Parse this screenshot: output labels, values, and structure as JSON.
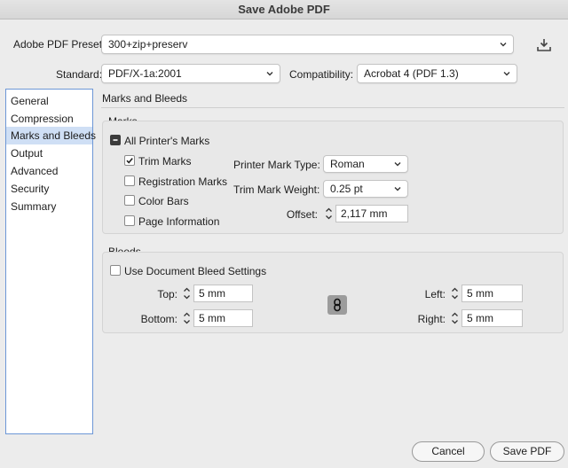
{
  "window": {
    "title": "Save Adobe PDF"
  },
  "preset": {
    "label": "Adobe PDF Preset:",
    "value": "300+zip+preserv"
  },
  "standard": {
    "label": "Standard:",
    "value": "PDF/X-1a:2001"
  },
  "compatibility": {
    "label": "Compatibility:",
    "value": "Acrobat 4 (PDF 1.3)"
  },
  "sidebar": {
    "items": [
      {
        "label": "General"
      },
      {
        "label": "Compression"
      },
      {
        "label": "Marks and Bleeds"
      },
      {
        "label": "Output"
      },
      {
        "label": "Advanced"
      },
      {
        "label": "Security"
      },
      {
        "label": "Summary"
      }
    ],
    "selected_index": 2
  },
  "panel": {
    "title": "Marks and Bleeds"
  },
  "marks": {
    "group_label": "Marks",
    "all_printers_marks": {
      "label": "All Printer's Marks",
      "state": "mixed"
    },
    "trim_marks": {
      "label": "Trim Marks",
      "checked": true
    },
    "registration_marks": {
      "label": "Registration Marks",
      "checked": false
    },
    "color_bars": {
      "label": "Color Bars",
      "checked": false
    },
    "page_information": {
      "label": "Page Information",
      "checked": false
    },
    "printer_mark_type": {
      "label": "Printer Mark Type:",
      "value": "Roman"
    },
    "trim_mark_weight": {
      "label": "Trim Mark Weight:",
      "value": "0.25 pt"
    },
    "offset": {
      "label": "Offset:",
      "value": "2,117 mm"
    }
  },
  "bleeds": {
    "group_label": "Bleeds",
    "use_document": {
      "label": "Use Document Bleed Settings",
      "checked": false
    },
    "top": {
      "label": "Top:",
      "value": "5 mm"
    },
    "bottom": {
      "label": "Bottom:",
      "value": "5 mm"
    },
    "left": {
      "label": "Left:",
      "value": "5 mm"
    },
    "right": {
      "label": "Right:",
      "value": "5 mm"
    }
  },
  "buttons": {
    "cancel": "Cancel",
    "save": "Save PDF"
  },
  "colors": {
    "sidebar_selection": "#cfdff5",
    "sidebar_border": "#6d97d6",
    "link_button": "#9c9c9c"
  }
}
